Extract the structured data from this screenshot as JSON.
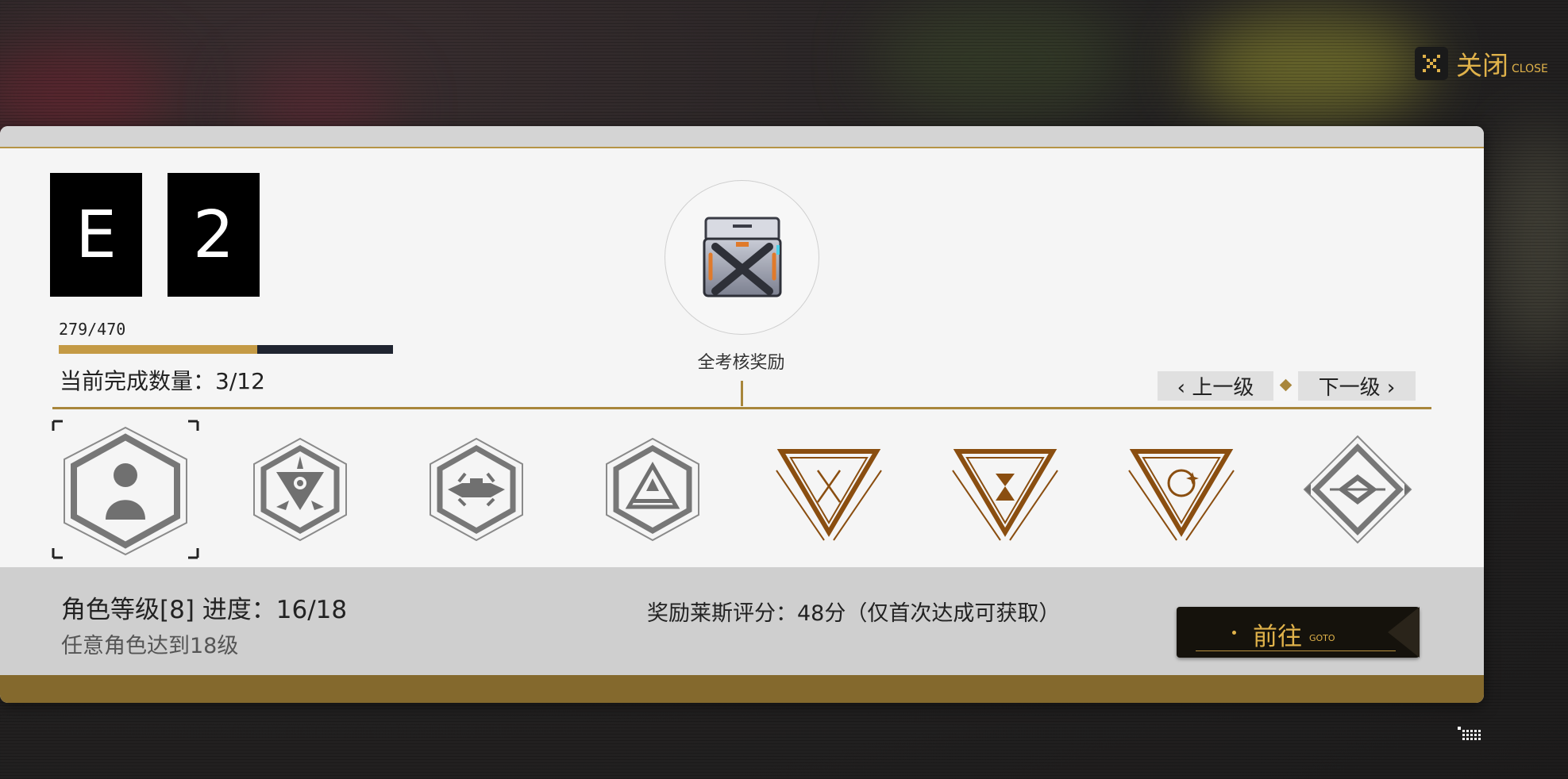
{
  "close": {
    "label": "关闭",
    "sub": "CLOSE"
  },
  "grade": {
    "letter": "E",
    "number": "2"
  },
  "experience": {
    "text": "279/470",
    "current": 279,
    "max": 470
  },
  "completion": {
    "text": "当前完成数量：3/12"
  },
  "full_reward": {
    "label": "全考核奖励"
  },
  "nav": {
    "prev": "‹ 上一级",
    "next": "下一级 ›"
  },
  "badges": [
    {
      "name": "character-badge",
      "selected": true
    },
    {
      "name": "star-eye-badge"
    },
    {
      "name": "ship-badge"
    },
    {
      "name": "pyramid-badge"
    },
    {
      "name": "sword-triangle-badge"
    },
    {
      "name": "hourglass-triangle-badge"
    },
    {
      "name": "target-triangle-badge"
    },
    {
      "name": "diamond-badge"
    }
  ],
  "task": {
    "title": "角色等级[8] 进度：16/18",
    "description": "任意角色达到18级",
    "reward": "奖励莱斯评分：48分（仅首次达成可获取）"
  },
  "goto": {
    "label": "前往",
    "sub": "GOTO"
  },
  "colors": {
    "gold": "#a8863b",
    "accent": "#e0b24a",
    "badge_bronze": "#8a4e10",
    "badge_gray": "#777777"
  }
}
